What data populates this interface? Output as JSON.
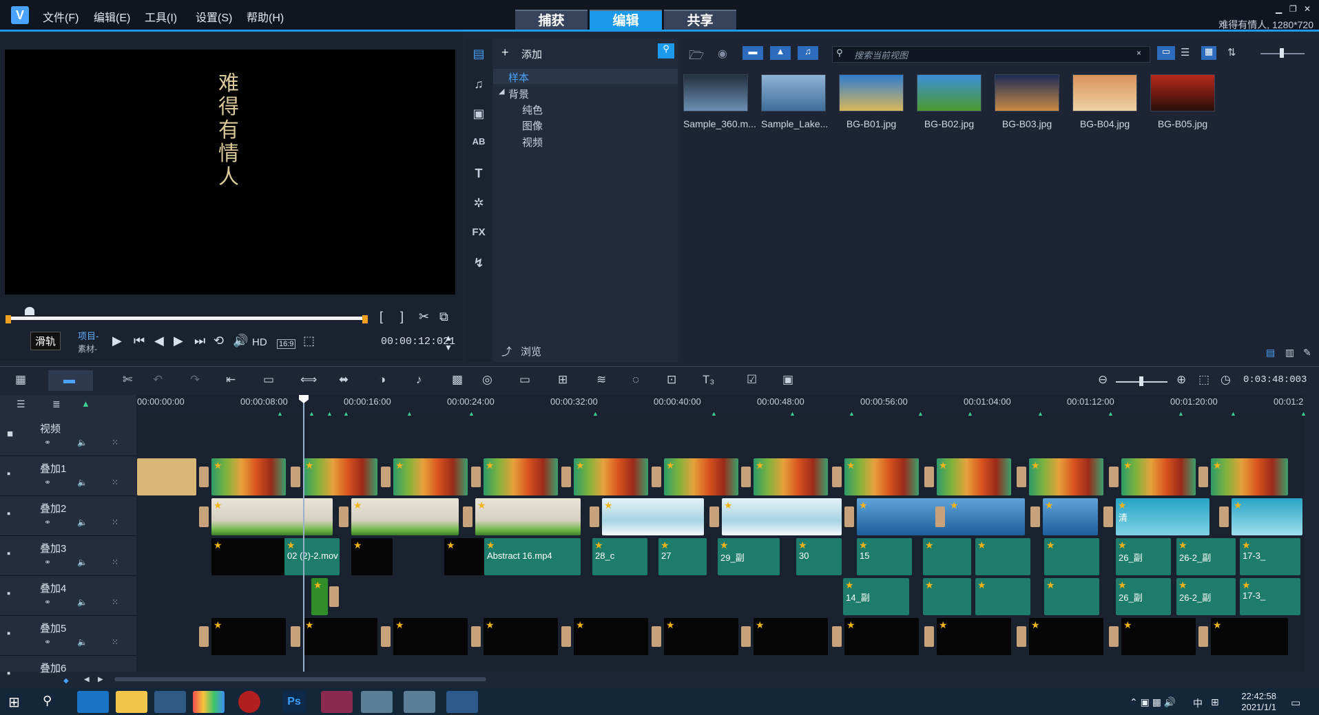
{
  "app": {
    "menus": [
      "文件(F)",
      "编辑(E)",
      "工具(I)",
      "设置(S)",
      "帮助(H)"
    ],
    "modes": [
      "捕获",
      "编辑",
      "共享"
    ],
    "active_mode": "编辑",
    "project_info": "难得有情人, 1280*720"
  },
  "preview": {
    "subtitle": "难得有情人",
    "tooltip": "滑轨",
    "project_label": "项目-",
    "source_label": "素材-",
    "quality": "HD",
    "aspect": "16:9",
    "timecode": "00:00:12:021"
  },
  "library": {
    "add_label": "添加",
    "tree": [
      "样本",
      "背景",
      "纯色",
      "图像",
      "视频"
    ],
    "browse_label": "浏览",
    "search_placeholder": "搜索当前视图",
    "thumbs": [
      {
        "name": "Sample_360.m...",
        "c1": "#23303f",
        "c2": "#6c8fb3"
      },
      {
        "name": "Sample_Lake...",
        "c1": "#8fb4d6",
        "c2": "#3f6e9c"
      },
      {
        "name": "BG-B01.jpg",
        "c1": "#2f7ccf",
        "c2": "#d9b75a"
      },
      {
        "name": "BG-B02.jpg",
        "c1": "#3c8fd8",
        "c2": "#4c9a2e"
      },
      {
        "name": "BG-B03.jpg",
        "c1": "#1d2c57",
        "c2": "#c98a45"
      },
      {
        "name": "BG-B04.jpg",
        "c1": "#d9925a",
        "c2": "#efd1a4"
      },
      {
        "name": "BG-B05.jpg",
        "c1": "#b8281a",
        "c2": "#2a0e0a"
      }
    ]
  },
  "timeline": {
    "timecode": "0:03:48:003",
    "ruler": [
      "00:00:00:00",
      "00:00:08:00",
      "00:00:16:00",
      "00:00:24:00",
      "00:00:32:00",
      "00:00:40:00",
      "00:00:48:00",
      "00:00:56:00",
      "00:01:04:00",
      "00:01:12:00",
      "00:01:20:00",
      "00:01:2"
    ],
    "tracks": [
      "视频",
      "叠加1",
      "叠加2",
      "叠加3",
      "叠加4",
      "叠加5",
      "叠加6"
    ],
    "clip_labels": {
      "a": "02 (2)-2.mov",
      "b": "Abstract 16.mp4",
      "c": "28_c",
      "d": "27",
      "e": "29_副",
      "f": "30",
      "g": "15",
      "h": "26_副",
      "i": "26-2_副",
      "j": "17-3_",
      "k": "14_副",
      "l": "清"
    }
  },
  "taskbar": {
    "time": "22:42:58",
    "date": "2021/1/1",
    "ime": "中"
  }
}
